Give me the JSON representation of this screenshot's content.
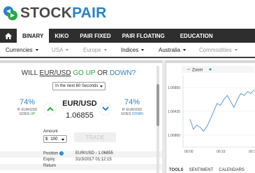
{
  "brand": {
    "name_part1": "STOCK",
    "name_part2": "PAIR",
    "colors": {
      "blue": "#2a83c9",
      "green": "#28a745",
      "dark": "#2e2e2e"
    },
    "logo_icon": "double-arrow-logo-icon"
  },
  "nav": {
    "home_icon": "home-icon",
    "items": [
      {
        "label": "BINARY",
        "active": true
      },
      {
        "label": "KIKO"
      },
      {
        "label": "PAIR FIXED"
      },
      {
        "label": "PAIR FLOATING"
      },
      {
        "label": "EDUCATION"
      }
    ]
  },
  "subnav": {
    "items": [
      {
        "label": "Currencies"
      },
      {
        "label": "USA"
      },
      {
        "label": "Europe"
      },
      {
        "label": "Indices"
      },
      {
        "label": "Australia"
      },
      {
        "label": "Commodities"
      }
    ]
  },
  "trade": {
    "question": {
      "prefix": "WILL",
      "pair": "EUR/USD",
      "go": "GO",
      "up": "UP",
      "or": "OR",
      "down": "DOWN?"
    },
    "expiry_select": "In the next 60 Seconds",
    "left_pct": "74%",
    "left_label_line1": "IF EUR/USD",
    "left_label_line2": "GOES",
    "left_label_dir": "UP",
    "right_pct": "74%",
    "right_label_line1": "IF EUR/USD",
    "right_label_line2": "GOES",
    "right_label_dir": "DOWN",
    "asset": "EUR/USD",
    "price": "1.06855",
    "amount_label": "Amount",
    "currency": "$",
    "amount_value": "100",
    "trade_button": "TRADE"
  },
  "details": {
    "position_label": "Position",
    "position_value": "EUR/USD  -  1.06855",
    "expiry_label": "Expiry",
    "expiry_value": "31/3/2017 01:12:15",
    "return_label": "Return"
  },
  "chart": {
    "zoom_label": "Zoom",
    "tabs": [
      {
        "label": "TOOLS",
        "active": true
      },
      {
        "label": "SENTIMENT"
      },
      {
        "label": "CALENDARS"
      }
    ]
  },
  "chart_data": {
    "type": "line",
    "title": "",
    "xlabel": "",
    "ylabel": "",
    "y_tick_labels": [
      "1.06850",
      "1.06425",
      "1.06800"
    ],
    "x_tick_labels": [
      "00:00",
      "00:15",
      "00:30"
    ],
    "series": [
      {
        "values": [
          1.0641,
          1.06385,
          1.06395,
          1.0639,
          1.0638,
          1.06392,
          1.0641,
          1.0643,
          1.0645,
          1.06445,
          1.0646,
          1.0647,
          1.06455,
          1.0644,
          1.0646,
          1.06475,
          1.0647,
          1.0648,
          1.06475,
          1.06485
        ]
      }
    ]
  }
}
